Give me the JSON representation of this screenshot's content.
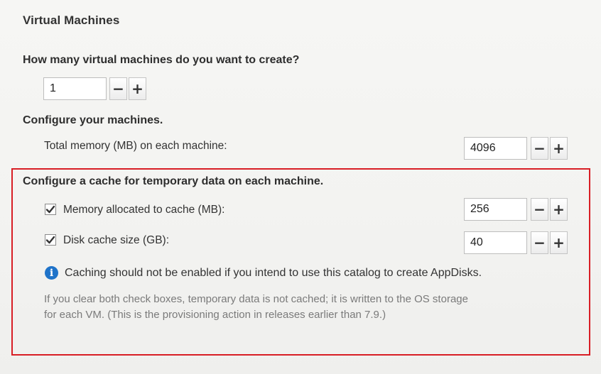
{
  "section_title": "Virtual Machines",
  "vm_count": {
    "question": "How many virtual machines do you want to create?",
    "value": "1",
    "minus": "−",
    "plus": "+"
  },
  "configure": {
    "heading": "Configure your machines.",
    "memory_label": "Total memory (MB) on each machine:",
    "memory_value": "4096",
    "minus": "−",
    "plus": "+"
  },
  "cache": {
    "heading": "Configure a cache for temporary data on each machine.",
    "memory_cache": {
      "checked": true,
      "label": "Memory allocated to cache (MB):",
      "value": "256",
      "minus": "−",
      "plus": "+"
    },
    "disk_cache": {
      "checked": true,
      "label": "Disk cache size (GB):",
      "value": "40",
      "minus": "−",
      "plus": "+"
    },
    "info_icon": "info-icon",
    "info_text": "Caching should not be enabled if you intend to use this catalog to create AppDisks.",
    "note_line1": "If you clear both check boxes, temporary data is not cached; it is written to the OS storage",
    "note_line2": "for each VM. (This is the provisioning action in releases earlier than 7.9.)"
  },
  "colors": {
    "highlight_border": "#d81e25",
    "info_icon_bg": "#1f73c9"
  }
}
